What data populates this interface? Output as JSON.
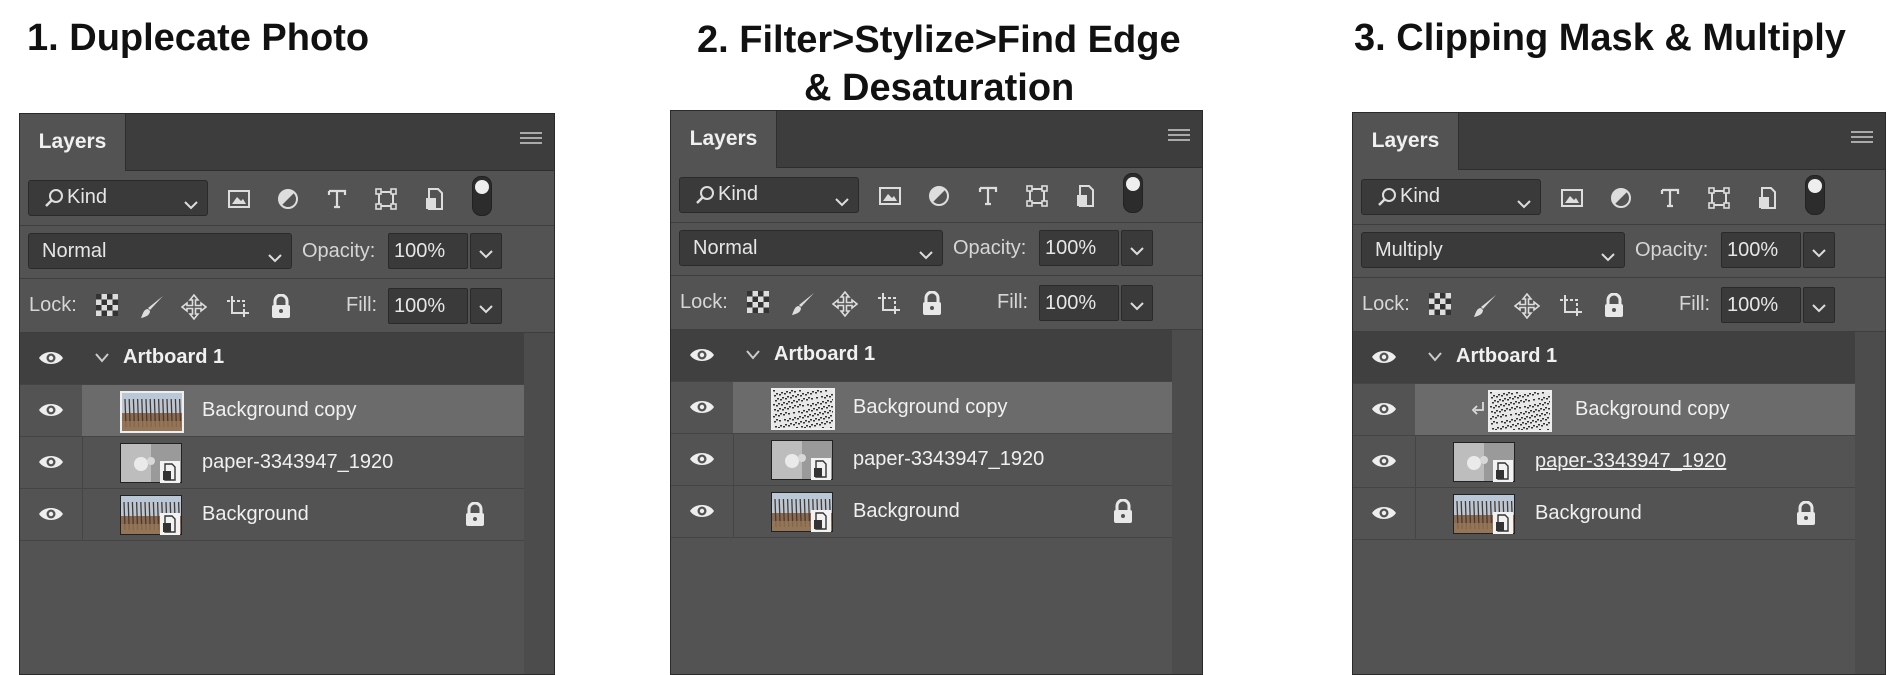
{
  "steps": [
    {
      "title_line1": "1. Duplecate Photo",
      "title_line2": "",
      "panel": {
        "tab": "Layers",
        "filter_kind": "Kind",
        "blend_mode": "Normal",
        "opacity_label": "Opacity:",
        "opacity": "100%",
        "lock_label": "Lock:",
        "fill_label": "Fill:",
        "fill": "100%",
        "group": "Artboard 1",
        "layers": [
          "Background copy",
          "paper-3343947_1920",
          "Background"
        ]
      }
    },
    {
      "title_line1": "2. Filter>Stylize>Find Edge",
      "title_line2": "& Desaturation",
      "panel": {
        "tab": "Layers",
        "filter_kind": "Kind",
        "blend_mode": "Normal",
        "opacity_label": "Opacity:",
        "opacity": "100%",
        "lock_label": "Lock:",
        "fill_label": "Fill:",
        "fill": "100%",
        "group": "Artboard 1",
        "layers": [
          "Background copy",
          "paper-3343947_1920",
          "Background"
        ]
      }
    },
    {
      "title_line1": "3. Clipping Mask & Multiply",
      "title_line2": "",
      "panel": {
        "tab": "Layers",
        "filter_kind": "Kind",
        "blend_mode": "Multiply",
        "opacity_label": "Opacity:",
        "opacity": "100%",
        "lock_label": "Lock:",
        "fill_label": "Fill:",
        "fill": "100%",
        "group": "Artboard 1",
        "layers": [
          "Background copy",
          "paper-3343947_1920",
          "Background"
        ]
      }
    }
  ],
  "colors": {
    "panel_bg": "#535353",
    "tabbar_bg": "#3d3d3d",
    "selected_row": "#6b6b6b",
    "group_row": "#404040"
  },
  "icons": [
    "search-icon",
    "image-filter-icon",
    "adjustment-filter-icon",
    "type-filter-icon",
    "shape-filter-icon",
    "smart-object-filter-icon",
    "eye-icon",
    "chevron-down-icon",
    "lock-transparent-icon",
    "brush-icon",
    "move-icon",
    "artboard-icon",
    "padlock-icon",
    "clip-arrow-icon"
  ]
}
